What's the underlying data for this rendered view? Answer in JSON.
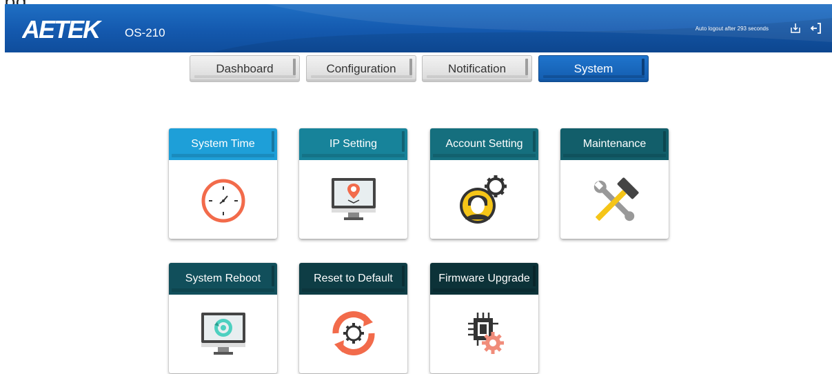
{
  "page_number": "pg",
  "header": {
    "logo_text": "AETEK",
    "model": "OS-210",
    "auto_logout": "Auto logout after 293 seconds"
  },
  "tabs": [
    {
      "label": "Dashboard",
      "active": false
    },
    {
      "label": "Configuration",
      "active": false
    },
    {
      "label": "Notification",
      "active": false
    },
    {
      "label": "System",
      "active": true
    }
  ],
  "cards": [
    {
      "label": "System Time",
      "color": "#1e9fd8",
      "icon": "clock-icon"
    },
    {
      "label": "IP Setting",
      "color": "#17839a",
      "icon": "monitor-location-icon"
    },
    {
      "label": "Account Setting",
      "color": "#156f7e",
      "icon": "user-gear-icon"
    },
    {
      "label": "Maintenance",
      "color": "#125e6a",
      "icon": "hammer-wrench-icon"
    },
    {
      "label": "System Reboot",
      "color": "#114f5b",
      "icon": "monitor-refresh-icon"
    },
    {
      "label": "Reset to Default",
      "color": "#0e3d45",
      "icon": "gear-refresh-icon"
    },
    {
      "label": "Firmware Upgrade",
      "color": "#0c3238",
      "icon": "chip-gear-icon"
    }
  ],
  "colors": {
    "header_blue": "#1459ae",
    "accent_orange": "#f26b4b",
    "accent_yellow": "#f5c518",
    "teal_icon": "#4dd0c0"
  }
}
